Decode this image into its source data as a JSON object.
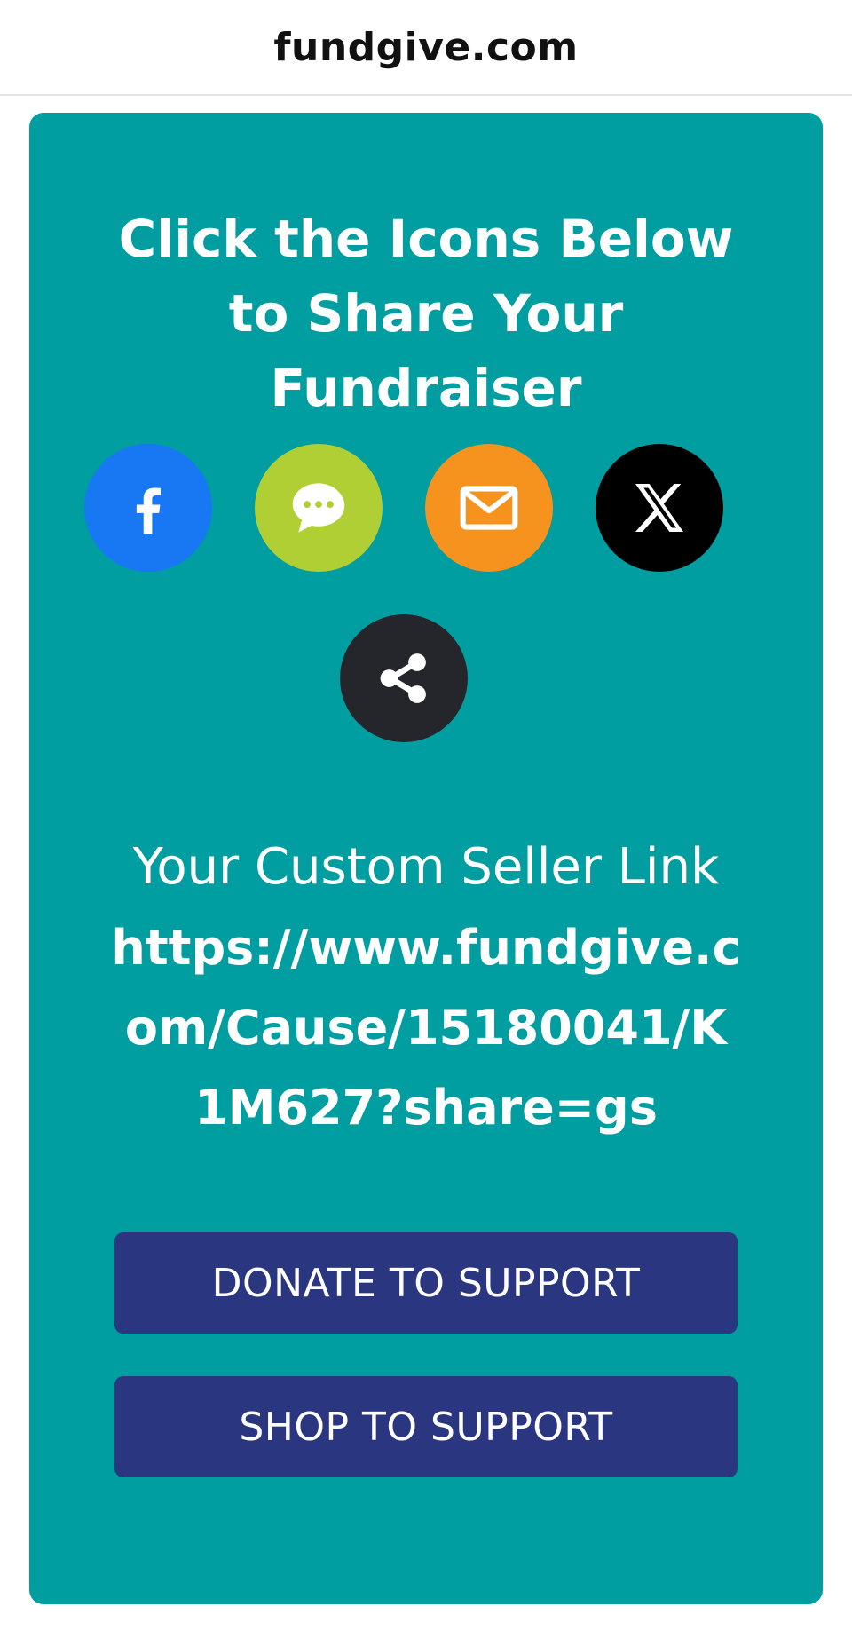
{
  "browser": {
    "domain": "fundgive.com"
  },
  "share_card": {
    "heading": "Click the Icons Below to Share Your Fundraiser",
    "icons": [
      {
        "name": "facebook-icon",
        "color": "#1877f2"
      },
      {
        "name": "message-icon",
        "color": "#b0cf34"
      },
      {
        "name": "email-icon",
        "color": "#f6931f"
      },
      {
        "name": "x-icon",
        "color": "#000000"
      },
      {
        "name": "share-icon",
        "color": "#24262b"
      }
    ],
    "seller_link_label": "Your Custom Seller Link",
    "seller_link_url": "https://www.fundgive.com/Cause/15180041/K1M627?share=gs",
    "donate_label": "DONATE TO SUPPORT",
    "shop_label": "SHOP TO SUPPORT",
    "card_color": "#009ea1",
    "button_color": "#2b3680"
  }
}
